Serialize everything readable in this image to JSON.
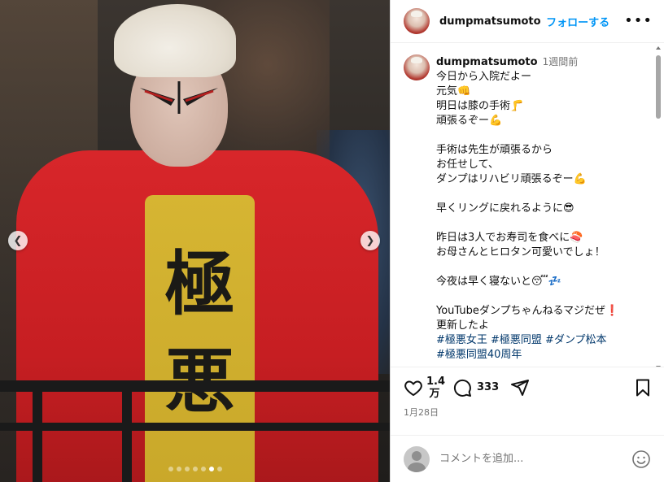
{
  "header": {
    "username": "dumpmatsumoto",
    "follow_label": "フォローする",
    "more_label": "•••"
  },
  "caption": {
    "username": "dumpmatsumoto",
    "time": "1週間前",
    "lines": [
      "今日から入院だよー",
      "元気👊",
      "明日は膝の手術🦵",
      "頑張るぞー💪",
      "",
      "手術は先生が頑張るから",
      "お任せして、",
      "ダンプはリハビリ頑張るぞー💪",
      "",
      "早くリングに戻れるように😎",
      "",
      "昨日は3人でお寿司を食べに🍣",
      "お母さんとヒロタン可愛いでしょ！",
      "",
      "今夜は早く寝ないと😴💤",
      "",
      "YouTubeダンプちゃんねるマジだぜ❗",
      "更新したよ"
    ],
    "hashtags_line1": "#極悪女王 #極悪同盟 #ダンプ松本",
    "hashtags_line2": "#極悪同盟40周年"
  },
  "image": {
    "shirt_kanji": "極悪",
    "carousel_count": 7,
    "carousel_active_index": 5,
    "prev_icon": "chevron-left",
    "next_icon": "chevron-right"
  },
  "actions": {
    "likes_line1": "1.4",
    "likes_line2": "万",
    "comments": "333",
    "date": "1月28日"
  },
  "add_comment": {
    "placeholder": "コメントを追加..."
  },
  "colors": {
    "accent": "#0095f6",
    "hashtag": "#00376b",
    "muted": "#737373"
  }
}
